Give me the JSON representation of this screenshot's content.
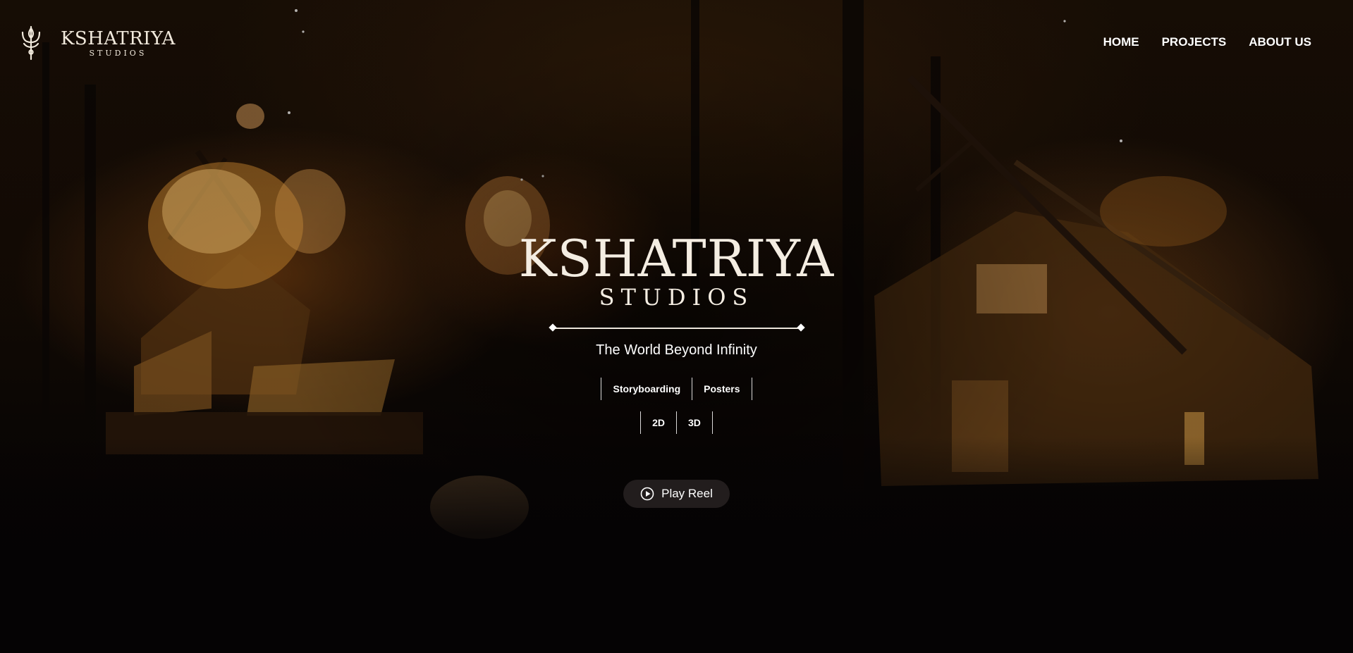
{
  "brand": {
    "logo_line1": "KSHATRIYA",
    "logo_line2": "STUDIOS",
    "logo_icon": "trident-icon"
  },
  "nav": {
    "items": [
      {
        "label": "HOME"
      },
      {
        "label": "PROJECTS"
      },
      {
        "label": "ABOUT US"
      }
    ]
  },
  "hero": {
    "title_line1": "KSHATRIYA",
    "title_line2": "STUDIOS",
    "tagline": "The World Beyond Infinity",
    "tags_row1": [
      "Storyboarding",
      "Posters"
    ],
    "tags_row2": [
      "2D",
      "3D"
    ],
    "play_label": "Play Reel",
    "play_icon": "play-circle-icon"
  },
  "colors": {
    "background": "#050304",
    "text": "#ffffff",
    "logo_cream": "#f1e9dc",
    "fire_glow": "#b8651a",
    "button_bg": "#282222"
  }
}
